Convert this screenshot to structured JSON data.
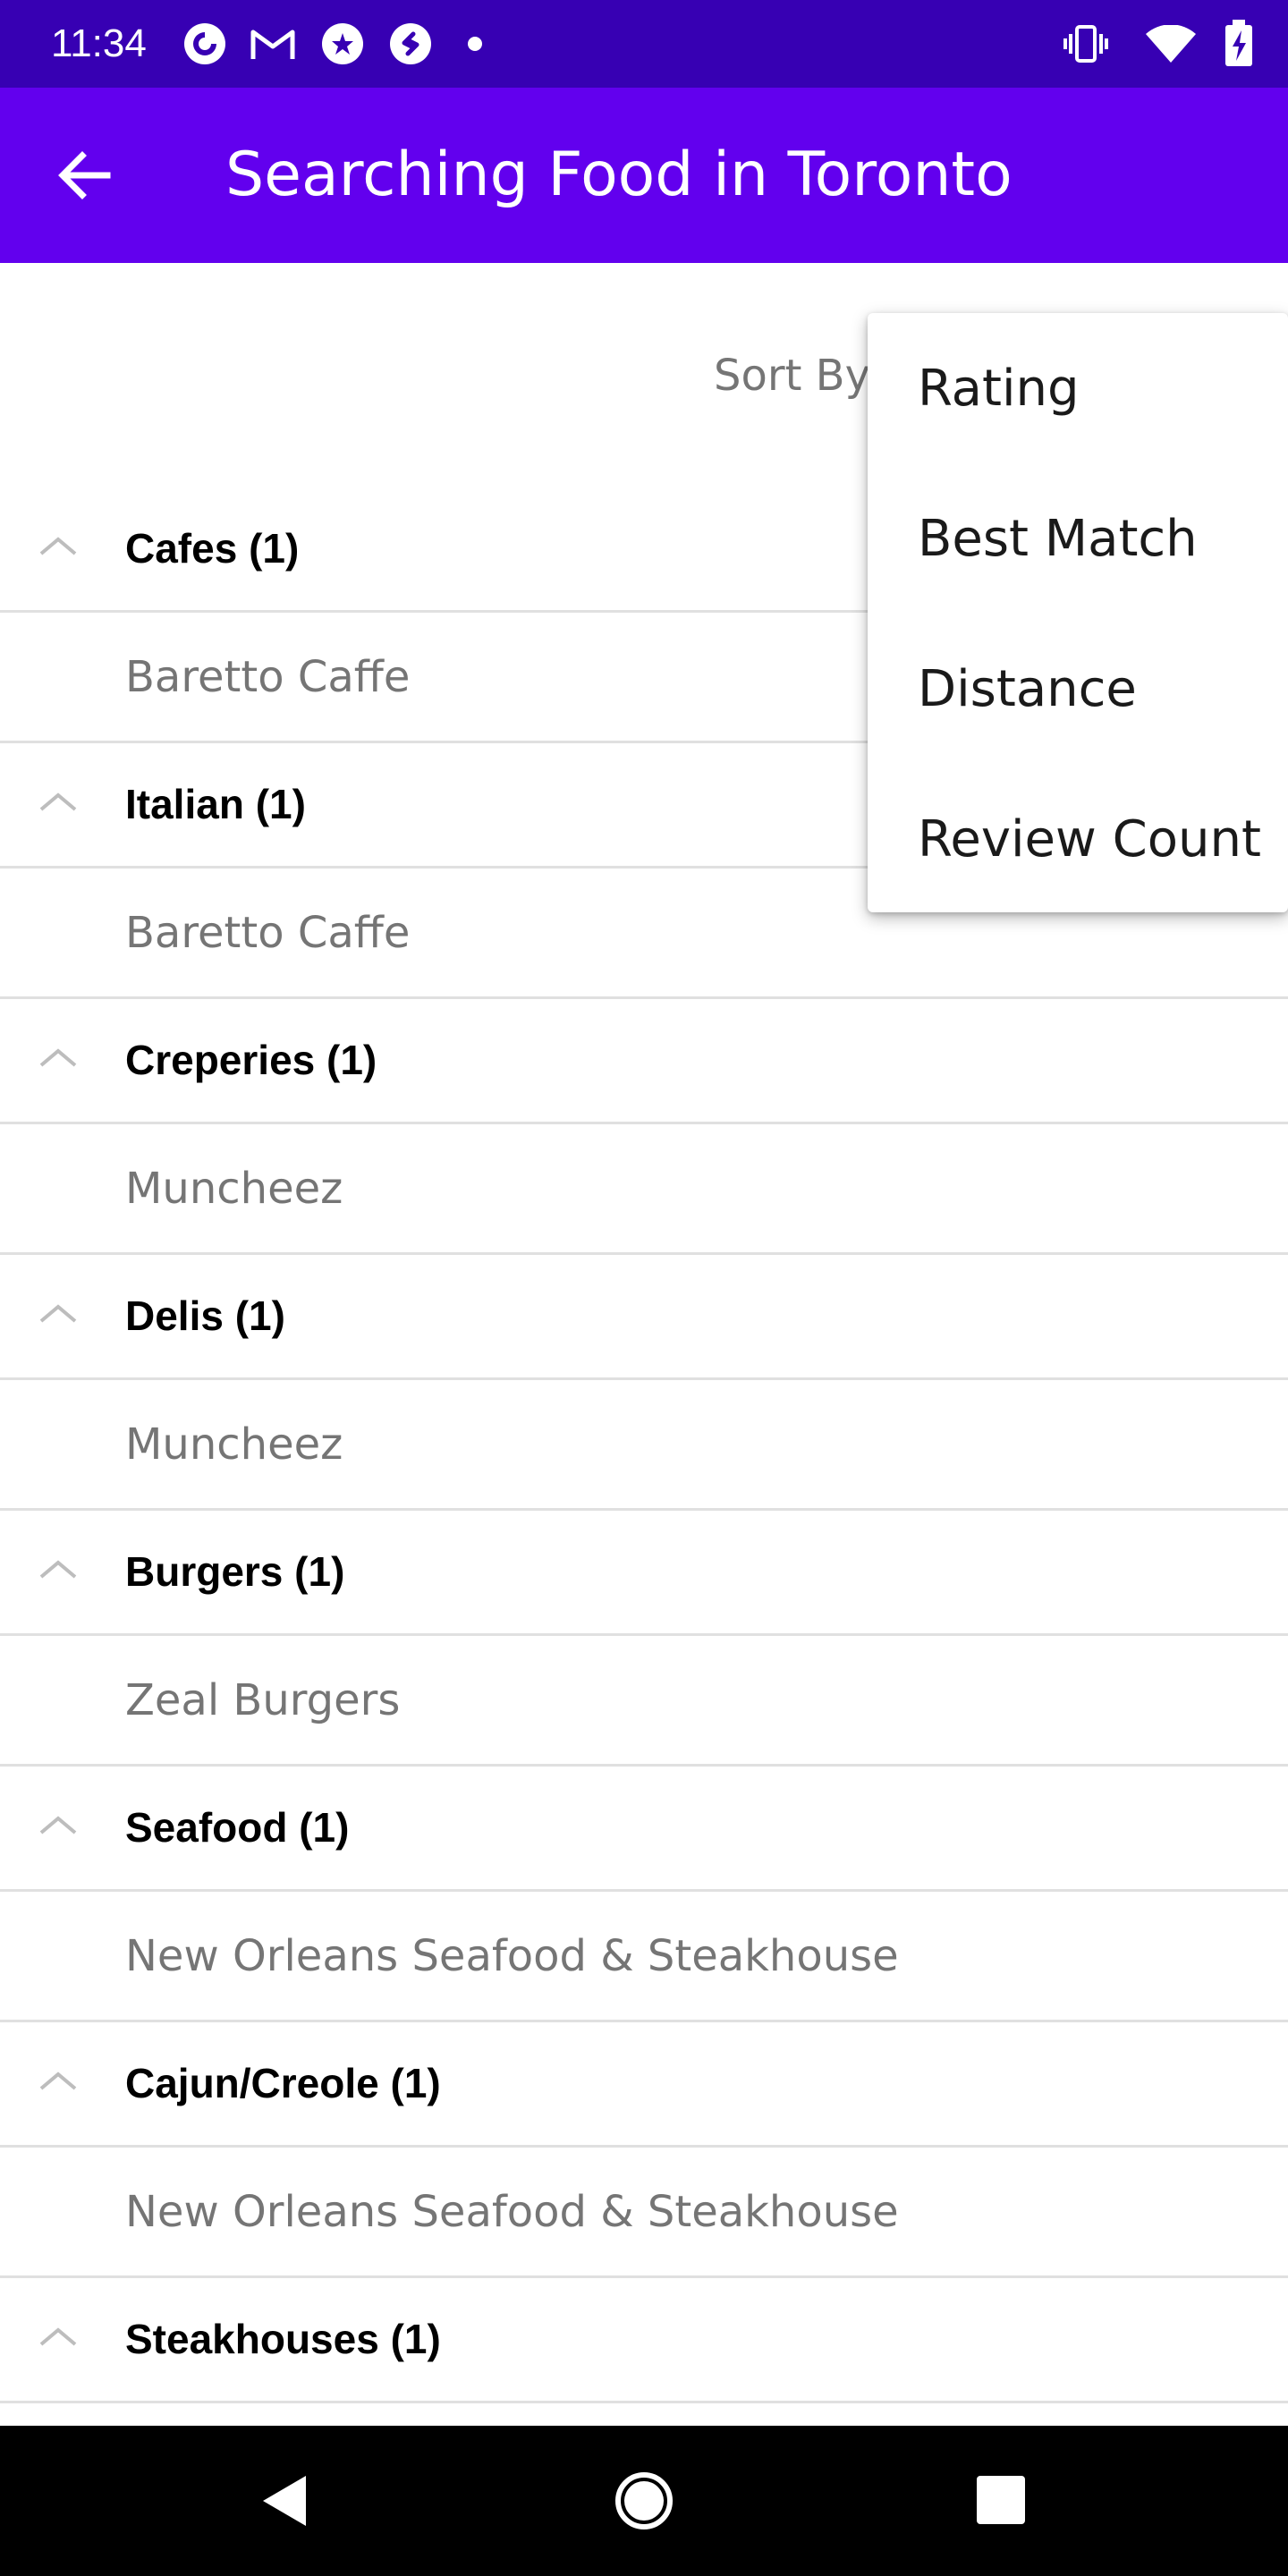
{
  "status_bar": {
    "time": "11:34",
    "left_icons": [
      "pocket-casts-icon",
      "gmail-icon",
      "star-notification-icon",
      "shazam-icon",
      "dot-icon"
    ],
    "right_icons": [
      "vibrate-icon",
      "wifi-icon",
      "battery-charging-icon"
    ]
  },
  "app_bar": {
    "back_icon": "arrow-back-icon",
    "title": "Searching Food in Toronto"
  },
  "sort": {
    "label": "Sort By:"
  },
  "sort_menu": {
    "options": [
      "Rating",
      "Best Match",
      "Distance",
      "Review Count"
    ]
  },
  "groups": [
    {
      "title": "Cafes (1)",
      "items": [
        "Baretto Caffe"
      ]
    },
    {
      "title": "Italian (1)",
      "items": [
        "Baretto Caffe"
      ]
    },
    {
      "title": "Creperies (1)",
      "items": [
        "Muncheez"
      ]
    },
    {
      "title": "Delis (1)",
      "items": [
        "Muncheez"
      ]
    },
    {
      "title": "Burgers (1)",
      "items": [
        "Zeal Burgers"
      ]
    },
    {
      "title": "Seafood (1)",
      "items": [
        "New Orleans Seafood & Steakhouse"
      ]
    },
    {
      "title": "Cajun/Creole (1)",
      "items": [
        "New Orleans Seafood & Steakhouse"
      ]
    },
    {
      "title": "Steakhouses (1)",
      "items": []
    }
  ],
  "colors": {
    "status_bar": "#3700b3",
    "app_bar": "#6200ee",
    "item_text": "#757575",
    "divider": "#e0e0e0"
  },
  "nav_bar": {
    "buttons": [
      "back-triangle-icon",
      "home-circle-icon",
      "recents-square-icon"
    ]
  }
}
